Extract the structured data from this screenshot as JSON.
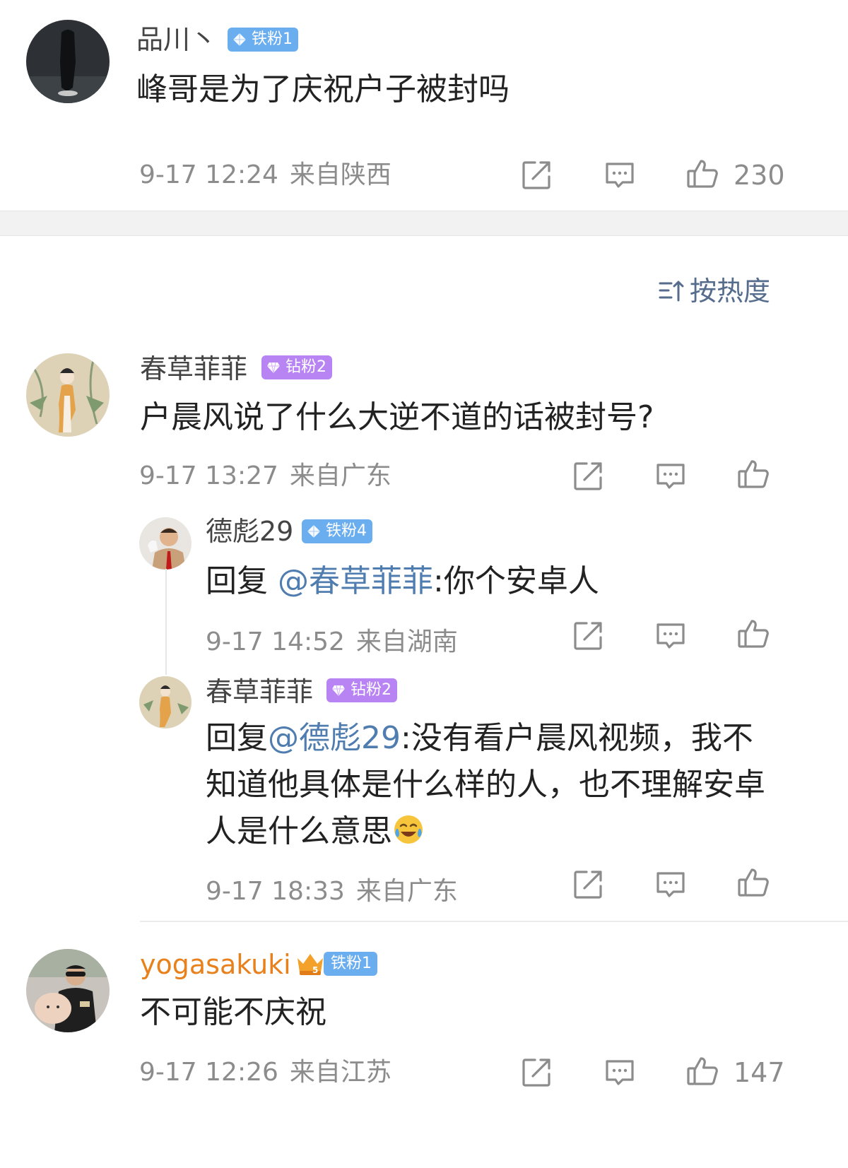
{
  "comments": [
    {
      "user": "品川丶",
      "badge": "铁粉1",
      "text": "峰哥是为了庆祝户子被封吗",
      "time": "9-17 12:24",
      "location": "来自陕西",
      "likes": "230"
    },
    {
      "user": "春草菲菲",
      "badge": "钻粉2",
      "text": "户晨风说了什么大逆不道的话被封号?",
      "time": "9-17 13:27",
      "location": "来自广东",
      "likes": "",
      "replies": [
        {
          "user": "德彪29",
          "badge": "铁粉4",
          "prefix": "回复 ",
          "mention": "@春草菲菲",
          "text": ":你个安卓人",
          "time": "9-17 14:52",
          "location": "来自湖南"
        },
        {
          "user": "春草菲菲",
          "badge": "钻粉2",
          "prefix": "回复",
          "mention": "@德彪29",
          "text": ":没有看户晨风视频，我不知道他具体是什么样的人，也不理解安卓人是什么意思",
          "time": "9-17 18:33",
          "location": "来自广东"
        }
      ]
    },
    {
      "user": "yogasakuki",
      "badge": "铁粉1",
      "text": "不可能不庆祝",
      "time": "9-17 12:26",
      "location": "来自江苏",
      "likes": "147"
    }
  ],
  "sort": {
    "label": "按热度"
  },
  "icons": {
    "share": "share-icon",
    "comment": "comment-icon",
    "like": "thumbs-up-icon",
    "sort": "sort-icon",
    "emoji": "laughing-tears-emoji"
  },
  "colors": {
    "mention": "#507daf",
    "meta": "#8c8c8c",
    "iron_badge": "#6aaef0",
    "drill_badge": "#b883f2",
    "vip_name": "#e8811c"
  }
}
